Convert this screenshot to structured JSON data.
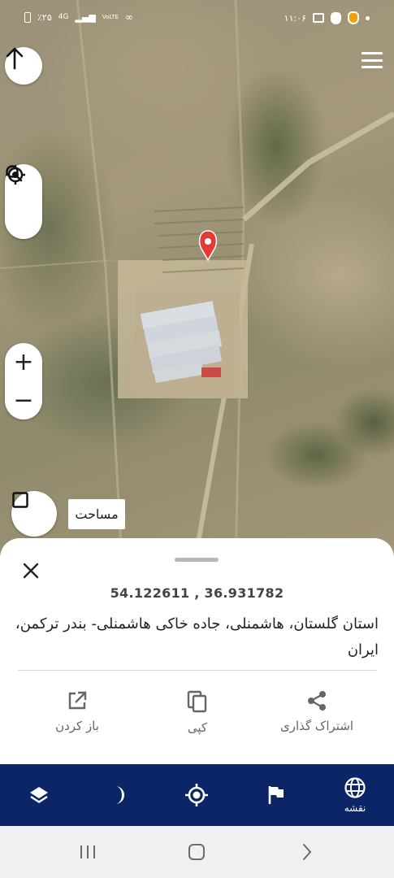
{
  "status_bar": {
    "battery": "٪۲۵",
    "network": "4G",
    "volte": "VoLTE",
    "time": "۱۱:۰۶"
  },
  "map": {
    "area_label": "مساحت",
    "zoom_in_label": "+",
    "zoom_out_label": "−",
    "marker_color": "#e53935"
  },
  "location_sheet": {
    "coordinates": "54.122611 , 36.931782",
    "address": "استان گلستان، هاشمنلی، جاده خاکی هاشمنلی- بندر ترکمن، ایران",
    "actions": [
      {
        "label": "اشتراک گذاری",
        "icon": "share-icon"
      },
      {
        "label": "کپی",
        "icon": "copy-icon"
      },
      {
        "label": "باز کردن",
        "icon": "open-external-icon"
      }
    ]
  },
  "bottom_nav": {
    "background": "#0c2566",
    "items": [
      {
        "icon": "layers-icon",
        "label": ""
      },
      {
        "icon": "night-mode-icon",
        "label": ""
      },
      {
        "icon": "my-location-icon",
        "label": ""
      },
      {
        "icon": "flag-icon",
        "label": ""
      },
      {
        "icon": "globe-icon",
        "label": "نقشه",
        "active": true
      }
    ]
  },
  "system_nav": {
    "buttons": [
      "recent-apps",
      "home",
      "back"
    ]
  }
}
